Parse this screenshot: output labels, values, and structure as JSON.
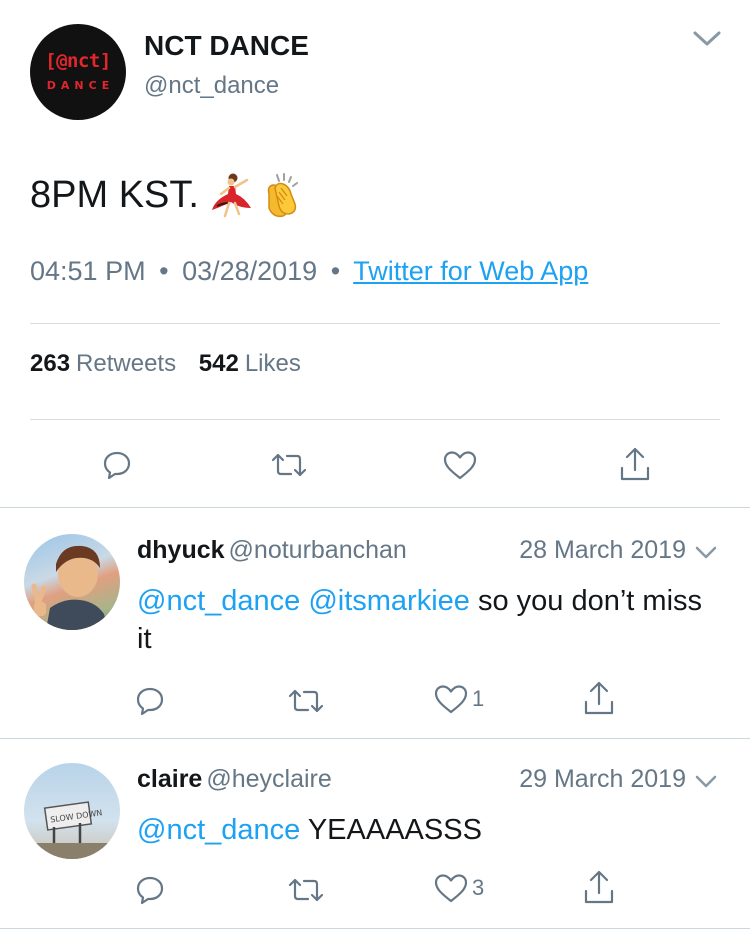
{
  "tweet": {
    "avatar_text_top": "[@nct]",
    "avatar_text_bottom": "DANCE",
    "name": "NCT DANCE",
    "handle": "@nct_dance",
    "text": "8PM KST.",
    "emoji": [
      "dancer-emoji",
      "clapping-hands-emoji"
    ],
    "time": "04:51 PM",
    "date": "03/28/2019",
    "separator": "•",
    "source": "Twitter for Web App",
    "retweets_count": "263",
    "retweets_label": "Retweets",
    "likes_count": "542",
    "likes_label": "Likes",
    "actions": [
      "reply-icon",
      "retweet-icon",
      "like-icon",
      "share-icon"
    ]
  },
  "replies": [
    {
      "name": "dhyuck",
      "handle": "@noturbanchan",
      "date": "28 March 2019",
      "mentions": "@nct_dance @itsmarkiee",
      "text": "so you don’t miss it",
      "likes": "1"
    },
    {
      "name": "claire",
      "handle": "@heyclaire",
      "date": "29 March 2019",
      "mentions": "@nct_dance",
      "text": "YEAAAASSS",
      "likes": "3"
    }
  ],
  "colors": {
    "link": "#1da1f2",
    "secondary_text": "#657786",
    "primary_text": "#14171a",
    "divider": "#d8dde1",
    "brand_red": "#e2262b"
  }
}
